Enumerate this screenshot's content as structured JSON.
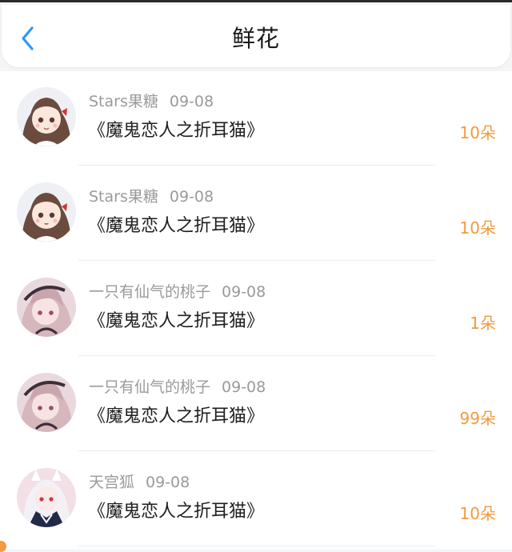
{
  "header": {
    "title": "鲜花",
    "back_icon": "chevron-left-icon",
    "accent": "#2b9af3"
  },
  "items": [
    {
      "user": "Stars果糖",
      "date": "09-08",
      "book": "《魔鬼恋人之折耳猫》",
      "count": "10朵",
      "avatar": "avatar-brown-hair-girl"
    },
    {
      "user": "Stars果糖",
      "date": "09-08",
      "book": "《魔鬼恋人之折耳猫》",
      "count": "10朵",
      "avatar": "avatar-brown-hair-girl"
    },
    {
      "user": "一只有仙气的桃子",
      "date": "09-08",
      "book": "《魔鬼恋人之折耳猫》",
      "count": "1朵",
      "avatar": "avatar-pink-hair-girl"
    },
    {
      "user": "一只有仙气的桃子",
      "date": "09-08",
      "book": "《魔鬼恋人之折耳猫》",
      "count": "99朵",
      "avatar": "avatar-pink-hair-girl"
    },
    {
      "user": "天宫狐",
      "date": "09-08",
      "book": "《魔鬼恋人之折耳猫》",
      "count": "10朵",
      "avatar": "avatar-white-hair-fox-girl"
    }
  ],
  "colors": {
    "count": "#f29a3f",
    "meta": "#9a9a9a",
    "text": "#1e1e1e"
  }
}
